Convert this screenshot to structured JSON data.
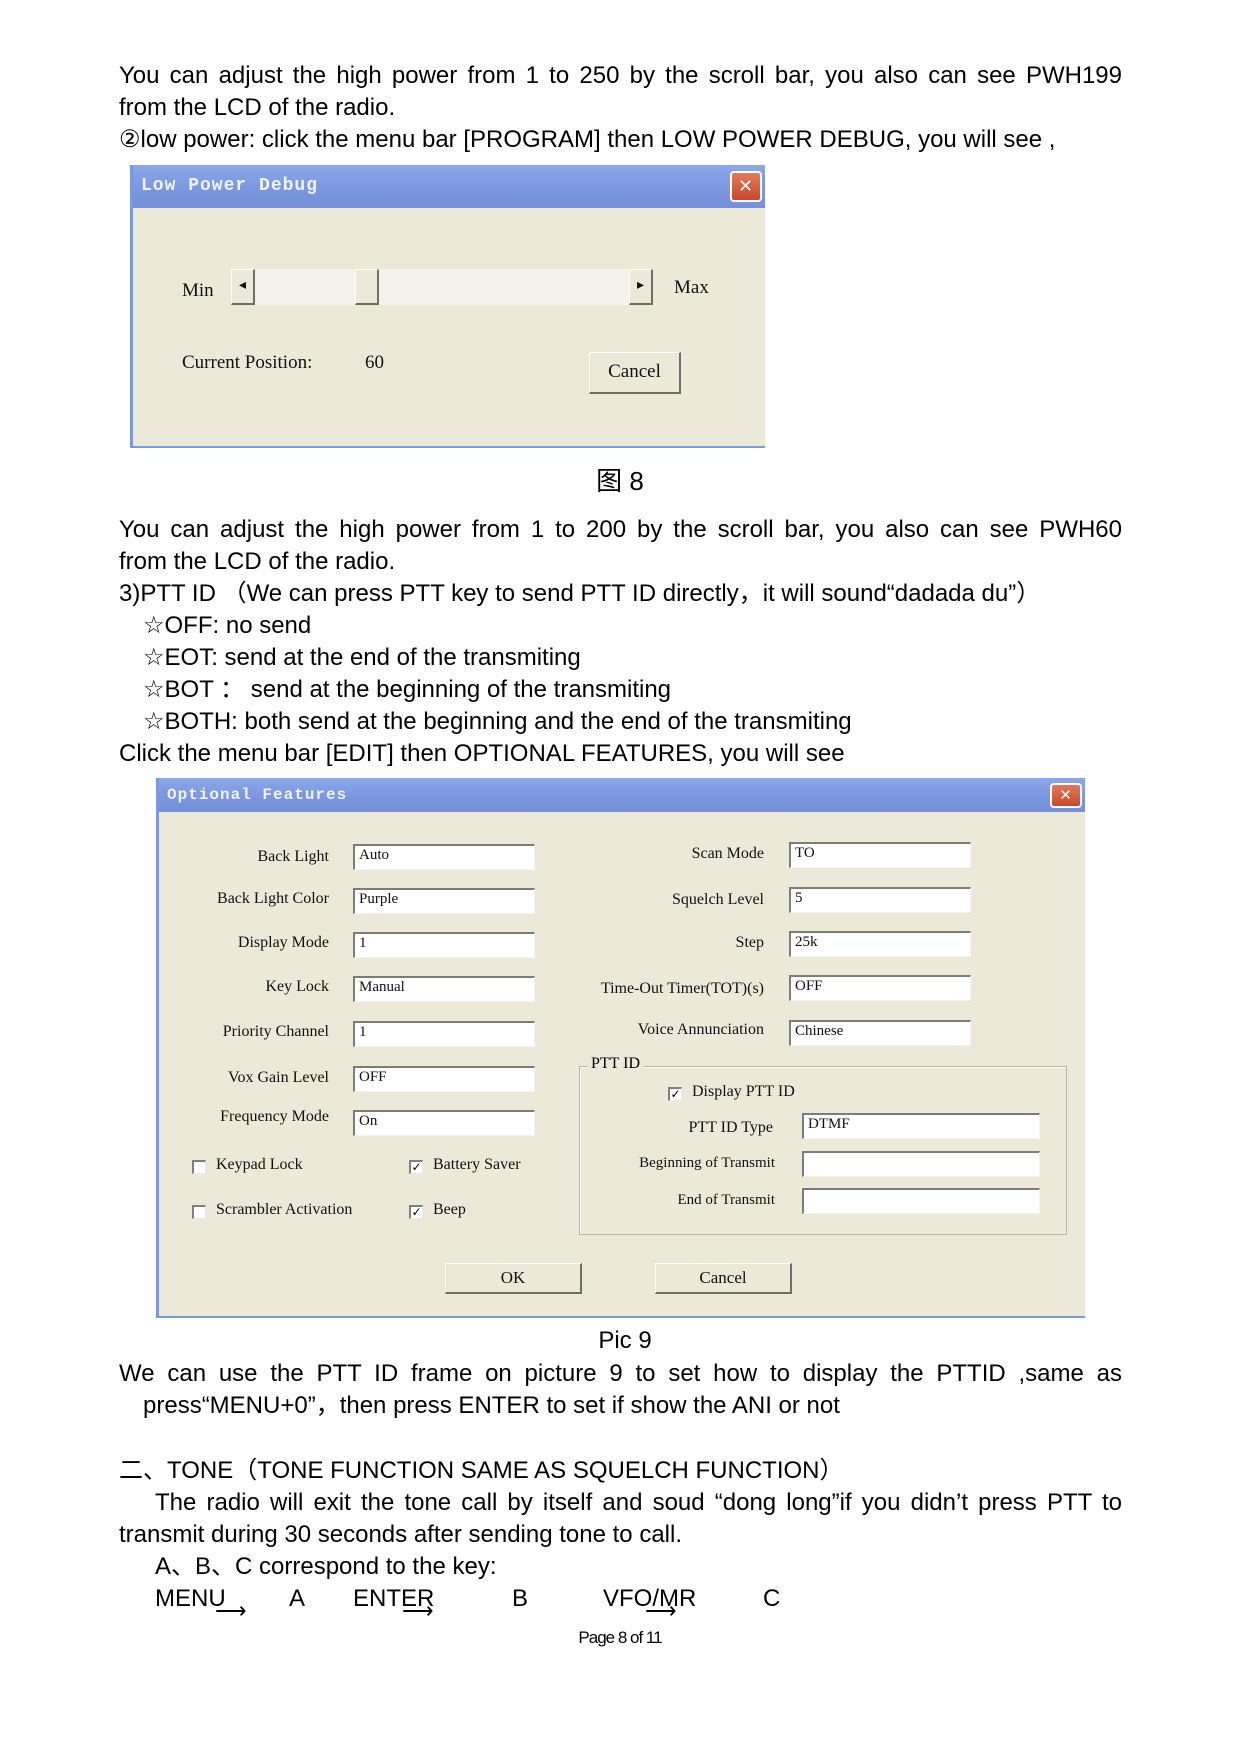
{
  "paragraphs": {
    "p1_line1": "You can adjust the high power from 1 to 250 by the scroll bar, you also can see PWH199",
    "p1_line2": "from the LCD of the radio.",
    "p2": "②low power: click the menu bar [PROGRAM] then LOW POWER DEBUG, you will see ,",
    "fig8_caption": "图 8",
    "p3_line1": "You can adjust the high power from 1 to 200 by the scroll bar, you also can see PWH60",
    "p3_line2": "from the LCD of the radio.",
    "ptt_heading": "3)PTT ID （We can press PTT key to send PTT ID directly，it will sound“dadada du”）",
    "ptt_options": [
      "☆OFF:  no send",
      "☆EOT:  send at the end of the transmiting",
      "☆BOT ：  send at the beginning of the transmiting",
      "☆BOTH:  both send at the beginning and the end of the transmiting"
    ],
    "p4": "Click the menu bar [EDIT] then OPTIONAL FEATURES, you will see",
    "fig9_caption": "Pic 9",
    "p5_line1": "We can use the PTT ID frame on picture 9 to set how to display the PTTID ,same as",
    "p5_line2": "press“MENU+0”，then press ENTER to set if show the ANI or not",
    "tone_heading": "二、TONE（TONE FUNCTION SAME AS SQUELCH FUNCTION）",
    "tone_line1": "The radio will exit the tone call by itself and soud “dong long”if you didn’t press PTT to",
    "tone_line2": "transmit during 30 seconds after sending tone to call.",
    "abc_line": "A、B、C correspond to the key:",
    "key_map": [
      {
        "key": "MENU",
        "letter": "A"
      },
      {
        "key": "ENTER",
        "letter": "B"
      },
      {
        "key": "VFO/MR",
        "letter": "C"
      }
    ]
  },
  "low_power_dialog": {
    "title": "Low Power Debug",
    "close_icon": "✕",
    "min_label": "Min",
    "max_label": "Max",
    "left_arrow": "◂",
    "right_arrow": "▸",
    "slider_value_fraction": 0.3,
    "current_position_label": "Current Position:",
    "current_position_value": "60",
    "cancel_label": "Cancel"
  },
  "optional_features_dialog": {
    "title": "Optional Features",
    "close_icon": "✕",
    "left_fields": [
      {
        "label": "Back Light",
        "value": "Auto"
      },
      {
        "label": "Back Light Color",
        "value": "Purple"
      },
      {
        "label": "Display Mode",
        "value": "1"
      },
      {
        "label": "Key Lock",
        "value": "Manual"
      },
      {
        "label": "Priority Channel",
        "value": "1"
      },
      {
        "label": "Vox Gain Level",
        "value": "OFF"
      },
      {
        "label": "Frequency Mode",
        "value": "On"
      }
    ],
    "right_fields": [
      {
        "label": "Scan Mode",
        "value": "TO"
      },
      {
        "label": "Squelch Level",
        "value": "5"
      },
      {
        "label": "Step",
        "value": "25k"
      },
      {
        "label": "Time-Out Timer(TOT)(s)",
        "value": "OFF"
      },
      {
        "label": "Voice Annunciation",
        "value": "Chinese"
      }
    ],
    "checkboxes": [
      {
        "label": "Keypad Lock",
        "checked": false,
        "mark": ""
      },
      {
        "label": "Battery Saver",
        "checked": true,
        "mark": "✓"
      },
      {
        "label": "Scrambler Activation",
        "checked": false,
        "mark": ""
      },
      {
        "label": "Beep",
        "checked": true,
        "mark": "✓"
      }
    ],
    "ptt_group": {
      "title": "PTT ID",
      "display_label": "Display PTT ID",
      "display_checked": true,
      "display_mark": "✓",
      "type_label": "PTT ID Type",
      "type_value": "DTMF",
      "bot_label": "Beginning of Transmit",
      "bot_value": "",
      "eot_label": "End of Transmit",
      "eot_value": ""
    },
    "ok_label": "OK",
    "cancel_label": "Cancel"
  },
  "footer": {
    "page_label": "Page 8 of 11"
  }
}
